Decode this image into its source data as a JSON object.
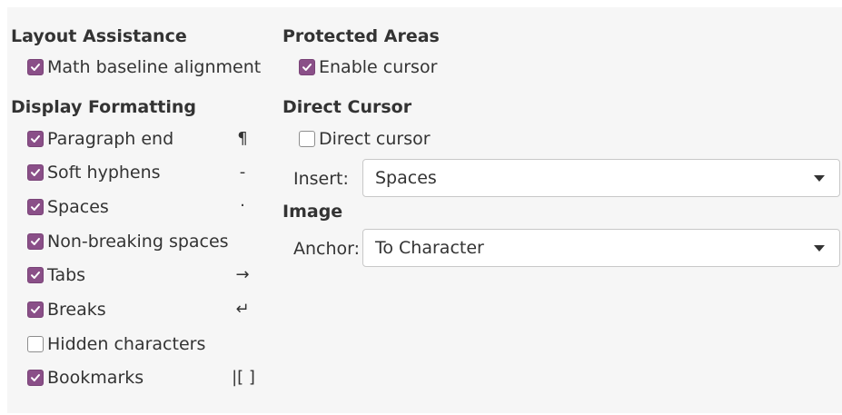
{
  "layout_assistance": {
    "heading": "Layout Assistance",
    "math_baseline": {
      "label": "Math baseline alignment",
      "checked": true
    }
  },
  "display_formatting": {
    "heading": "Display Formatting",
    "items": [
      {
        "label": "Paragraph end",
        "symbol": "¶",
        "checked": true
      },
      {
        "label": "Soft hyphens",
        "symbol": "-",
        "checked": true
      },
      {
        "label": "Spaces",
        "symbol": "·",
        "checked": true
      },
      {
        "label": "Non-breaking spaces",
        "symbol": "",
        "checked": true
      },
      {
        "label": "Tabs",
        "symbol": "→",
        "checked": true
      },
      {
        "label": "Breaks",
        "symbol": "↵",
        "checked": true
      },
      {
        "label": "Hidden characters",
        "symbol": "",
        "checked": false
      },
      {
        "label": "Bookmarks",
        "symbol": "|[ ]",
        "checked": true
      }
    ]
  },
  "protected_areas": {
    "heading": "Protected Areas",
    "enable_cursor": {
      "label": "Enable cursor",
      "checked": true
    }
  },
  "direct_cursor": {
    "heading": "Direct Cursor",
    "checkbox": {
      "label": "Direct cursor",
      "checked": false
    },
    "insert_label": "Insert:",
    "insert_value": "Spaces"
  },
  "image": {
    "heading": "Image",
    "anchor_label": "Anchor:",
    "anchor_value": "To Character"
  },
  "colors": {
    "accent": "#8a4f88",
    "panel_background": "#f6f6f6"
  }
}
